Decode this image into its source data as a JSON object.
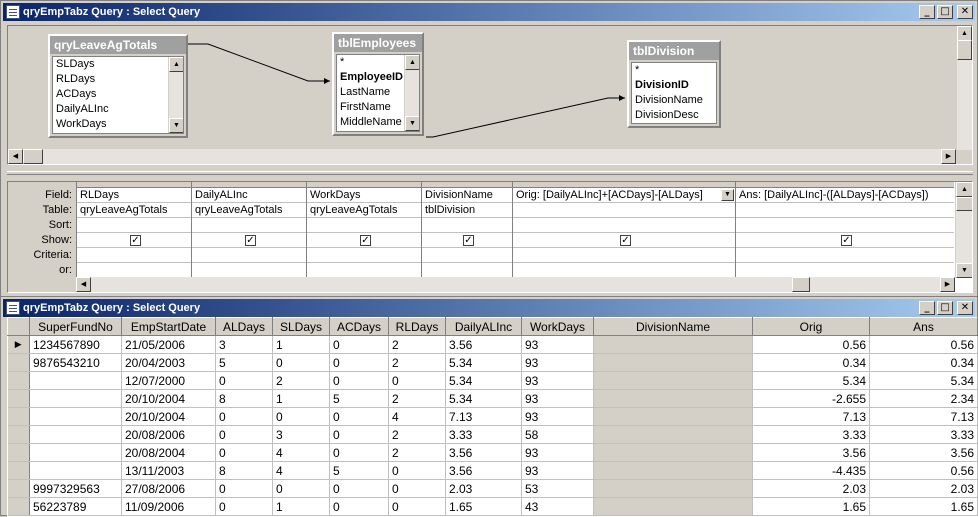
{
  "design_window": {
    "title": "qryEmpTabz Query : Select Query",
    "buttons": {
      "minimize": "_",
      "maximize": "□",
      "close": "✕"
    },
    "tables": [
      {
        "name": "qryLeaveAgTotals",
        "fields": [
          "SLDays",
          "RLDays",
          "ACDays",
          "DailyALInc",
          "WorkDays"
        ]
      },
      {
        "name": "tblEmployees",
        "fields": [
          "*",
          "EmployeeID",
          "LastName",
          "FirstName",
          "MiddleName"
        ]
      },
      {
        "name": "tblDivision",
        "fields": [
          "*",
          "DivisionID",
          "DivisionName",
          "DivisionDesc"
        ]
      }
    ],
    "grid_labels": [
      "Field:",
      "Table:",
      "Sort:",
      "Show:",
      "Criteria:",
      "or:"
    ],
    "grid_columns": [
      {
        "field": "RLDays",
        "table": "qryLeaveAgTotals",
        "show": true
      },
      {
        "field": "DailyALInc",
        "table": "qryLeaveAgTotals",
        "show": true
      },
      {
        "field": "WorkDays",
        "table": "qryLeaveAgTotals",
        "show": true
      },
      {
        "field": "DivisionName",
        "table": "tblDivision",
        "show": true
      },
      {
        "field": "Orig: [DailyALInc]+[ACDays]-[ALDays]",
        "table": "",
        "show": true
      },
      {
        "field": "Ans: [DailyALInc]-([ALDays]-[ACDays])",
        "table": "",
        "show": true
      }
    ]
  },
  "sheet_window": {
    "title": "qryEmpTabz Query : Select Query",
    "columns": [
      "SuperFundNo",
      "EmpStartDate",
      "ALDays",
      "SLDays",
      "ACDays",
      "RLDays",
      "DailyALInc",
      "WorkDays",
      "DivisionName",
      "Orig",
      "Ans"
    ],
    "rows": [
      [
        "1234567890",
        "21/05/2006",
        "3",
        "1",
        "0",
        "2",
        "3.56",
        "93",
        "",
        "0.56",
        "0.56"
      ],
      [
        "9876543210",
        "20/04/2003",
        "5",
        "0",
        "0",
        "2",
        "5.34",
        "93",
        "",
        "0.34",
        "0.34"
      ],
      [
        "",
        "12/07/2000",
        "0",
        "2",
        "0",
        "0",
        "5.34",
        "93",
        "",
        "5.34",
        "5.34"
      ],
      [
        "",
        "20/10/2004",
        "8",
        "1",
        "5",
        "2",
        "5.34",
        "93",
        "",
        "-2.655",
        "2.34"
      ],
      [
        "",
        "20/10/2004",
        "0",
        "0",
        "0",
        "4",
        "7.13",
        "93",
        "",
        "7.13",
        "7.13"
      ],
      [
        "",
        "20/08/2006",
        "0",
        "3",
        "0",
        "2",
        "3.33",
        "58",
        "",
        "3.33",
        "3.33"
      ],
      [
        "",
        "20/08/2004",
        "0",
        "4",
        "0",
        "2",
        "3.56",
        "93",
        "",
        "3.56",
        "3.56"
      ],
      [
        "",
        "13/11/2003",
        "8",
        "4",
        "5",
        "0",
        "3.56",
        "93",
        "",
        "-4.435",
        "0.56"
      ],
      [
        "9997329563",
        "27/08/2006",
        "0",
        "0",
        "0",
        "0",
        "2.03",
        "53",
        "",
        "2.03",
        "2.03"
      ],
      [
        "56223789",
        "11/09/2006",
        "0",
        "1",
        "0",
        "0",
        "1.65",
        "43",
        "",
        "1.65",
        "1.65"
      ]
    ],
    "current_row_marker": "▶"
  }
}
